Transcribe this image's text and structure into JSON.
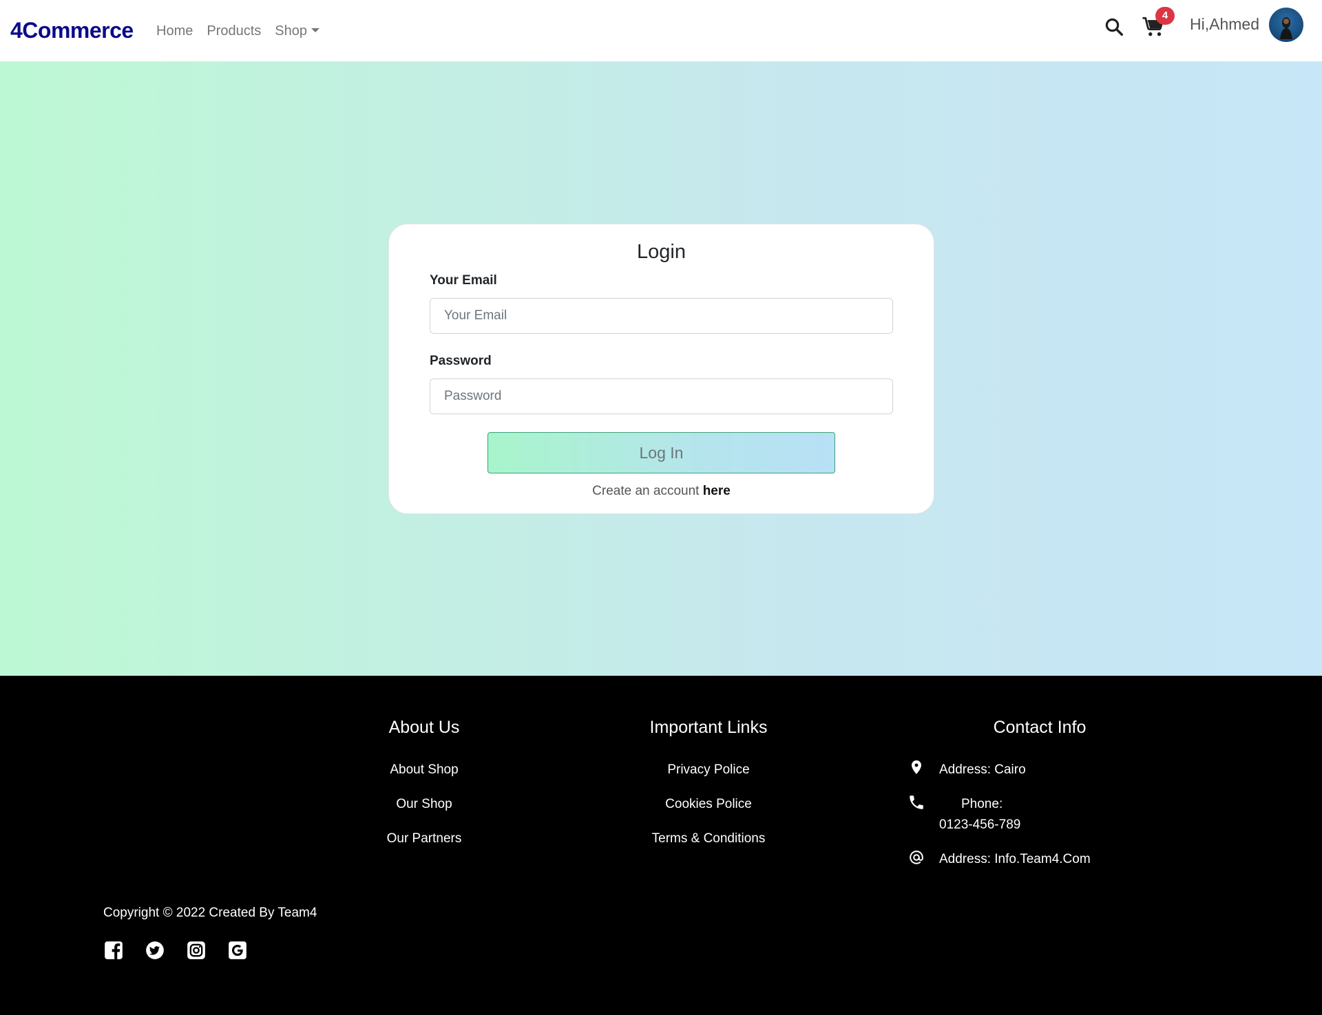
{
  "navbar": {
    "brand": "4Commerce",
    "links": [
      {
        "label": "Home"
      },
      {
        "label": "Products"
      },
      {
        "label": "Shop"
      }
    ],
    "cart_count": "4",
    "greeting": "Hi,Ahmed",
    "icons": {
      "search": "search-icon",
      "cart": "cart-icon",
      "avatar": "user-avatar"
    }
  },
  "login": {
    "title": "Login",
    "email_label": "Your Email",
    "email_placeholder": "Your Email",
    "email_value": "",
    "password_label": "Password",
    "password_placeholder": "Password",
    "password_value": "",
    "button_label": "Log In",
    "create_text": "Create an account ",
    "create_link": "here"
  },
  "footer": {
    "about": {
      "title": "About Us",
      "links": [
        "About Shop",
        "Our Shop",
        "Our Partners"
      ]
    },
    "important": {
      "title": "Important Links",
      "links": [
        "Privacy Police",
        "Cookies Police",
        "Terms & Conditions"
      ]
    },
    "contact": {
      "title": "Contact Info",
      "address": "Address: Cairo",
      "phone_label": "Phone:",
      "phone_number": "0123-456-789",
      "email": "Address: Info.Team4.Com"
    },
    "copyright": "Copyright © 2022 Created By Team4",
    "social": [
      "facebook-icon",
      "twitter-icon",
      "instagram-icon",
      "google-icon"
    ]
  },
  "colors": {
    "brand": "#0b0b8a",
    "badge": "#dc3545",
    "gradient_start": "#bdf8d4",
    "gradient_end": "#c7e6f7"
  }
}
